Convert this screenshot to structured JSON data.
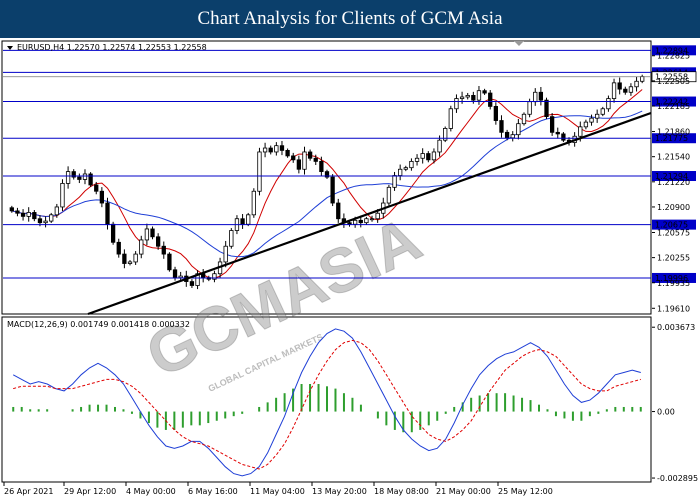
{
  "header": {
    "title": "Chart Analysis for Clients of GCM Asia"
  },
  "watermark": {
    "main": "GCMASIA",
    "sub": "GLOBAL CAPITAL MARKETS"
  },
  "colors": {
    "banner": "#0b3f6b",
    "level_line": "#0000c8",
    "level_label_bg": "#0000c8",
    "ma_fast": "#d00000",
    "ma_slow": "#1f3fd6",
    "trendline": "#000000",
    "candle_up": "#ffffff",
    "candle_down": "#000000",
    "macd_line": "#1f3fd6",
    "signal_line": "#e00000",
    "histogram": "#2e9e2e"
  },
  "chart_data": [
    {
      "type": "candlestick",
      "symbol_info": "EURUSD,H4  1.22570 1.22574 1.22553 1.22558",
      "ylim": [
        1.1955,
        1.23
      ],
      "y_ticks": [
        "1.22825",
        "1.22505",
        "1.22185",
        "1.21860",
        "1.21540",
        "1.21220",
        "1.20900",
        "1.20575",
        "1.20255",
        "1.19935",
        "1.19610"
      ],
      "levels": [
        {
          "value": 1.22894,
          "label": "1.22894"
        },
        {
          "value": 1.22614,
          "label": "1.22614"
        },
        {
          "value": 1.22242,
          "label": "1.22242"
        },
        {
          "value": 1.21775,
          "label": "1.21775"
        },
        {
          "value": 1.21294,
          "label": "1.21294"
        },
        {
          "value": 1.20675,
          "label": "1.20675"
        },
        {
          "value": 1.19996,
          "label": "1.19996"
        }
      ],
      "current_price": {
        "value": 1.22558,
        "label": "1.22558"
      },
      "x_labels": [
        "26 Apr 2021",
        "29 Apr 12:00",
        "4 May 00:00",
        "6 May 16:00",
        "11 May 04:00",
        "13 May 20:00",
        "18 May 08:00",
        "21 May 00:00",
        "25 May 12:00"
      ],
      "close_path": [
        1.2085,
        1.2082,
        1.2078,
        1.2083,
        1.2075,
        1.207,
        1.2072,
        1.208,
        1.209,
        1.212,
        1.2135,
        1.2128,
        1.2125,
        1.2132,
        1.2118,
        1.211,
        1.2095,
        1.2068,
        1.2045,
        1.203,
        1.2018,
        1.202,
        1.203,
        1.2048,
        1.2062,
        1.2052,
        1.204,
        1.203,
        1.201,
        1.2,
        1.2002,
        1.1995,
        1.199,
        1.2005,
        1.2,
        1.1998,
        1.2005,
        1.202,
        1.204,
        1.206,
        1.2075,
        1.2068,
        1.208,
        1.211,
        1.216,
        1.2165,
        1.216,
        1.2168,
        1.2162,
        1.2155,
        1.215,
        1.2138,
        1.216,
        1.2152,
        1.2148,
        1.2135,
        1.2128,
        1.2095,
        1.2075,
        1.207,
        1.2068,
        1.2073,
        1.207,
        1.2075,
        1.2075,
        1.2082,
        1.2095,
        1.2115,
        1.213,
        1.2138,
        1.214,
        1.2148,
        1.2152,
        1.2158,
        1.215,
        1.216,
        1.2175,
        1.219,
        1.2215,
        1.2228,
        1.223,
        1.2232,
        1.2226,
        1.2238,
        1.2235,
        1.2218,
        1.22,
        1.2185,
        1.2178,
        1.2182,
        1.2196,
        1.2208,
        1.2224,
        1.2236,
        1.2226,
        1.2205,
        1.2185,
        1.2183,
        1.2175,
        1.2172,
        1.218,
        1.2192,
        1.2198,
        1.2203,
        1.2208,
        1.2215,
        1.2228,
        1.2248,
        1.224,
        1.2236,
        1.2243,
        1.225,
        1.2256
      ]
    },
    {
      "type": "macd",
      "label": "MACD(12,26,9) 0.001749 0.001418 0.000332",
      "ylim": [
        -0.00298,
        0.0039
      ],
      "y_ticks": [
        {
          "value": 0.003673,
          "label": "0.003673"
        },
        {
          "value": 0.0,
          "label": "0.00"
        },
        {
          "value": -0.002895,
          "label": "-0.002895"
        }
      ],
      "macd": [
        0.0016,
        0.0014,
        0.0012,
        0.0013,
        0.0012,
        0.001,
        0.0009,
        0.0012,
        0.0016,
        0.0019,
        0.0021,
        0.0019,
        0.0016,
        0.0012,
        0.0006,
        0.0,
        -0.0006,
        -0.0011,
        -0.0015,
        -0.0016,
        -0.0015,
        -0.0013,
        -0.0013,
        -0.0016,
        -0.002,
        -0.0024,
        -0.0027,
        -0.0028,
        -0.0027,
        -0.0024,
        -0.0018,
        -0.001,
        -0.0002,
        0.0008,
        0.0017,
        0.0024,
        0.003,
        0.0034,
        0.0036,
        0.0035,
        0.0032,
        0.0026,
        0.0019,
        0.0012,
        0.0005,
        -0.0002,
        -0.0008,
        -0.0012,
        -0.0015,
        -0.0017,
        -0.0016,
        -0.0012,
        -0.0005,
        0.0003,
        0.001,
        0.0016,
        0.002,
        0.0023,
        0.0025,
        0.0026,
        0.0028,
        0.003,
        0.0028,
        0.0024,
        0.0018,
        0.0012,
        0.0007,
        0.0004,
        0.0005,
        0.0008,
        0.0012,
        0.0016,
        0.0017,
        0.0018,
        0.0017
      ],
      "signal": [
        0.001,
        0.0011,
        0.0011,
        0.0011,
        0.0011,
        0.001,
        0.001,
        0.001,
        0.0011,
        0.0012,
        0.0013,
        0.0014,
        0.0014,
        0.0013,
        0.0011,
        0.0008,
        0.0004,
        0.0,
        -0.0004,
        -0.0008,
        -0.0011,
        -0.0013,
        -0.0014,
        -0.0015,
        -0.0017,
        -0.0019,
        -0.0021,
        -0.0023,
        -0.0024,
        -0.0025,
        -0.0023,
        -0.0019,
        -0.0014,
        -0.0007,
        0.0001,
        0.0009,
        0.0016,
        0.0022,
        0.0027,
        0.003,
        0.0031,
        0.003,
        0.0027,
        0.0022,
        0.0016,
        0.001,
        0.0004,
        -0.0002,
        -0.0006,
        -0.001,
        -0.0012,
        -0.0013,
        -0.0011,
        -0.0008,
        -0.0004,
        0.0002,
        0.0008,
        0.0013,
        0.0018,
        0.0021,
        0.0024,
        0.0026,
        0.0027,
        0.0026,
        0.0024,
        0.002,
        0.0016,
        0.0012,
        0.001,
        0.0009,
        0.0009,
        0.0011,
        0.0012,
        0.0013,
        0.0014
      ],
      "histogram": [
        0.0002,
        0.0002,
        0.0001,
        0.0001,
        0.0001,
        0.0,
        0.0,
        0.0001,
        0.0002,
        0.0003,
        0.0003,
        0.0003,
        0.0002,
        0.0001,
        -0.0001,
        -0.0003,
        -0.0005,
        -0.0007,
        -0.0008,
        -0.0008,
        -0.0007,
        -0.0006,
        -0.0006,
        -0.0005,
        -0.0004,
        -0.0003,
        -0.0002,
        -0.0001,
        0.0,
        0.0002,
        0.0004,
        0.0006,
        0.0008,
        0.001,
        0.0012,
        0.0012,
        0.0012,
        0.0011,
        0.001,
        0.0008,
        0.0006,
        0.0003,
        0.0,
        -0.0003,
        -0.0006,
        -0.0008,
        -0.0009,
        -0.0009,
        -0.0008,
        -0.0006,
        -0.0004,
        -0.0001,
        0.0002,
        0.0004,
        0.0006,
        0.0007,
        0.0008,
        0.0008,
        0.0008,
        0.0007,
        0.0006,
        0.0005,
        0.0003,
        0.0001,
        -0.0002,
        -0.0003,
        -0.0004,
        -0.0004,
        -0.0002,
        -0.0001,
        0.0001,
        0.0002,
        0.0002,
        0.0002,
        0.0002
      ]
    }
  ]
}
